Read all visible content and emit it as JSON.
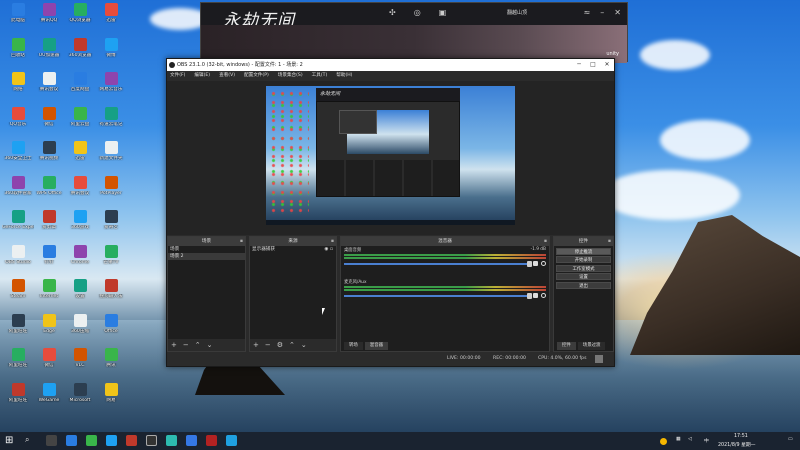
{
  "game_window": {
    "logo": "永劫无间",
    "user_label": "翻越山顶",
    "brand": "unity"
  },
  "obs": {
    "title": "OBS 23.1.0 (32-bit, windows) - 配置文件: 1 - 场景: 2",
    "menu": [
      "文件(F)",
      "编辑(E)",
      "查看(V)",
      "配置文件(P)",
      "场景集合(S)",
      "工具(T)",
      "帮助(H)"
    ],
    "docks": {
      "scenes": {
        "title": "场景",
        "items": [
          "场景",
          "场景 2"
        ],
        "selected_index": 1
      },
      "sources": {
        "title": "来源",
        "items": [
          "显示器捕获"
        ]
      },
      "mixer": {
        "title": "混音器",
        "channels": [
          {
            "name": "桌面音频",
            "db": "-1.9 dB"
          },
          {
            "name": "麦克风/Aux",
            "db": ""
          }
        ],
        "tabs": [
          "转场",
          "混音器"
        ],
        "active_tab": "混音器"
      },
      "controls": {
        "title": "控件",
        "buttons": [
          "停止推流",
          "开始录制",
          "工作室模式",
          "设置",
          "退出"
        ],
        "active_button": "停止推流",
        "tabs": [
          "控件",
          "场景过渡"
        ]
      }
    },
    "status": {
      "live": "LIVE: 00:00:00",
      "rec": "REC: 00:00:00",
      "cpu": "CPU: 4.0%, 60.00 fps"
    }
  },
  "desktop_icons": [
    [
      "此电脑",
      "回收站",
      "网络",
      "QQ音乐",
      "360安全卫士",
      "360软件管家",
      "GeForce Experience",
      "OBS Studio",
      "Steam",
      "阿里旺旺",
      "阿里旺旺",
      "阿里旺旺"
    ],
    [
      "腾讯QQ",
      "UU加速器",
      "腾讯会议",
      "微信",
      "腾讯视频",
      "WPS Office",
      "爱剪辑",
      "钉钉",
      "Internet",
      "Edge",
      "微信",
      "WeGame"
    ],
    [
      "QQ浏览器",
      "360浏览器",
      "百度网盘",
      "阿里云盘",
      "迅雷",
      "腾讯会议",
      "360游戏",
      "Chrome",
      "设置",
      "360压缩",
      "VLC",
      "Microsoft"
    ],
    [
      "迅雷",
      "微博",
      "网易云音乐",
      "有道云笔记",
      "新建文件夹",
      "PotPlayer",
      "爱奇艺",
      "芒果TV",
      "搜狗输入法",
      "Office",
      "腾讯",
      "网易"
    ]
  ],
  "taskbar": {
    "time": "17:51",
    "date": "2021/8/9 星期一",
    "ime": "中"
  }
}
